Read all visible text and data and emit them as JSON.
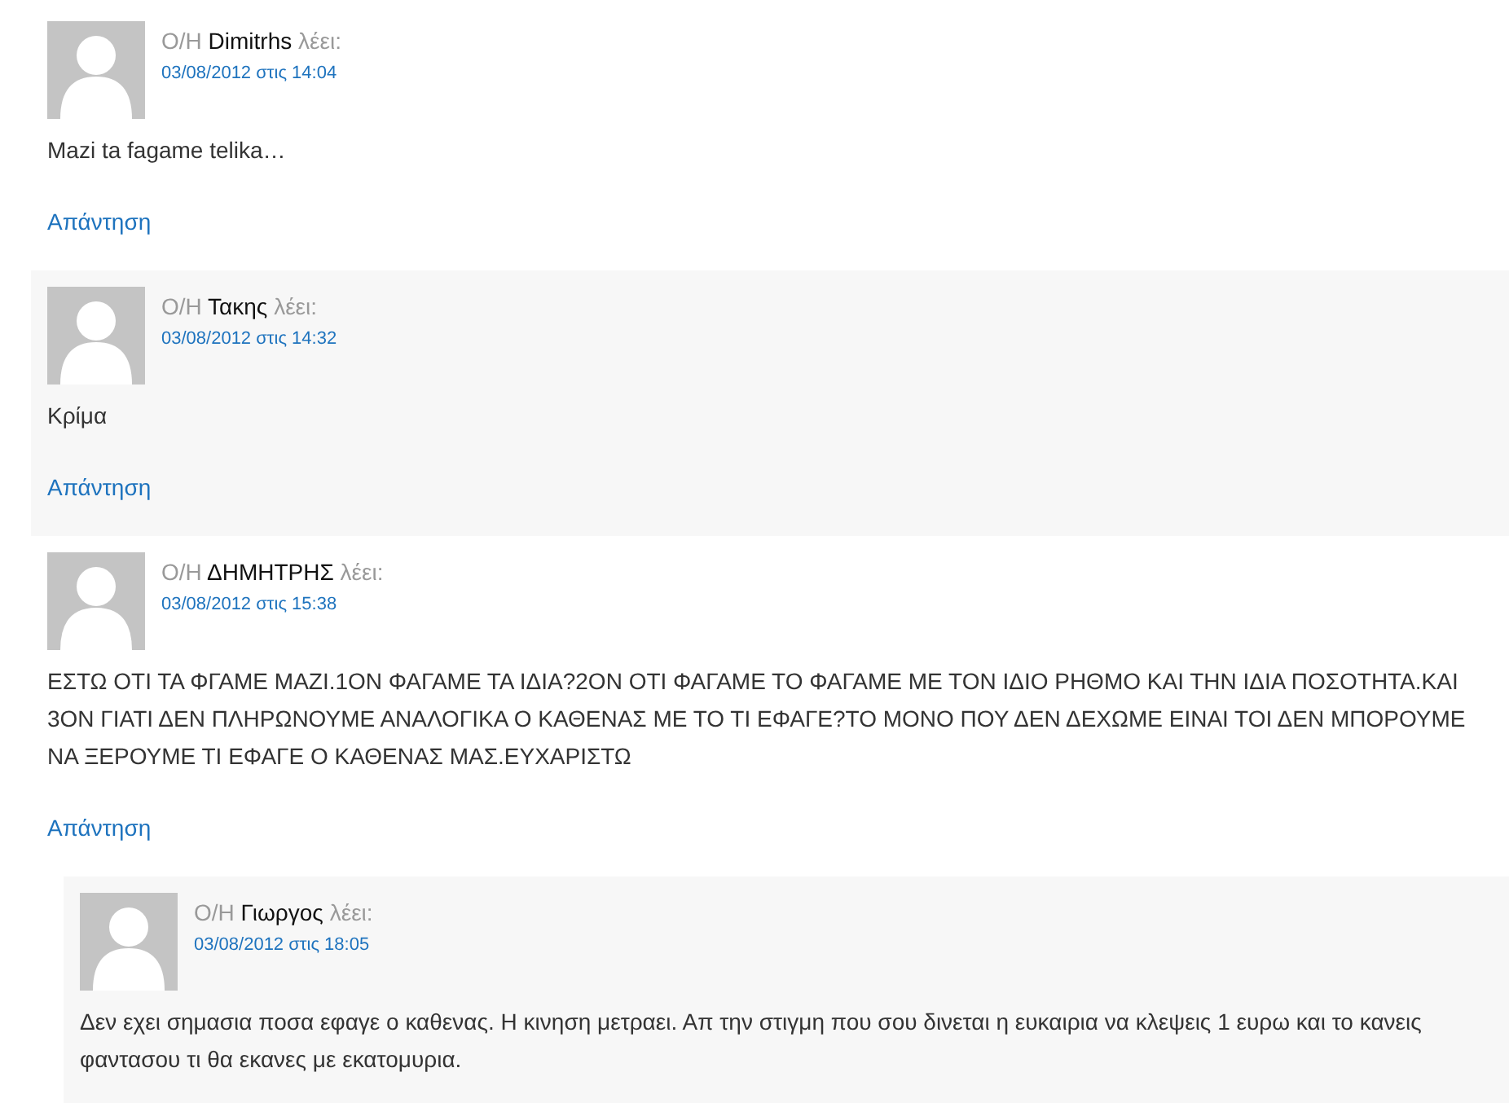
{
  "comments": [
    {
      "prefix": "Ο/Η",
      "author": "Dimitrhs",
      "says": "λέει:",
      "date": "03/08/2012 στις 14:04",
      "text": "Mazi ta fagame telika…",
      "reply": "Απάντηση"
    },
    {
      "prefix": "Ο/Η",
      "author": "Τακης",
      "says": "λέει:",
      "date": "03/08/2012 στις 14:32",
      "text": "Κρίμα",
      "reply": "Απάντηση"
    },
    {
      "prefix": "Ο/Η",
      "author": "ΔΗΜΗΤΡΗΣ",
      "says": "λέει:",
      "date": "03/08/2012 στις 15:38",
      "text": "ΕΣΤΩ ΟΤΙ ΤΑ ΦΓΑΜΕ ΜΑΖΙ.1ΟΝ ΦΑΓΑΜΕ ΤΑ ΙΔΙΑ?2ΟΝ ΟΤΙ ΦΑΓΑΜΕ ΤΟ ΦΑΓΑΜΕ ΜΕ ΤΟΝ ΙΔΙΟ ΡΗΘΜΟ ΚΑΙ ΤΗΝ ΙΔΙΑ ΠΟΣΟΤΗΤΑ.ΚΑΙ 3ΟΝ ΓΙΑΤΙ ΔΕΝ ΠΛΗΡΩΝΟΥΜΕ ΑΝΑΛΟΓΙΚΑ Ο ΚΑΘΕΝΑΣ ΜΕ ΤΟ ΤΙ ΕΦΑΓΕ?ΤΟ ΜΟΝΟ ΠΟΥ ΔΕΝ ΔΕΧΩΜΕ ΕΙΝΑΙ ΤΟΙ ΔΕΝ ΜΠΟΡΟΥΜΕ ΝΑ ΞΕΡΟΥΜΕ ΤΙ ΕΦΑΓΕ Ο ΚΑΘΕΝΑΣ ΜΑΣ.ΕΥΧΑΡΙΣΤΩ",
      "reply": "Απάντηση",
      "children": [
        {
          "prefix": "Ο/Η",
          "author": "Γιωργος",
          "says": "λέει:",
          "date": "03/08/2012 στις 18:05",
          "text": "Δεν εχει σημασια ποσα εφαγε ο καθενας. Η κινηση μετραει. Απ την στιγμη που σου δινεται η ευκαιρια να κλεψεις 1 ευρω και το κανεις φαντασου τι θα εκανες με εκατομυρια."
        }
      ]
    }
  ]
}
